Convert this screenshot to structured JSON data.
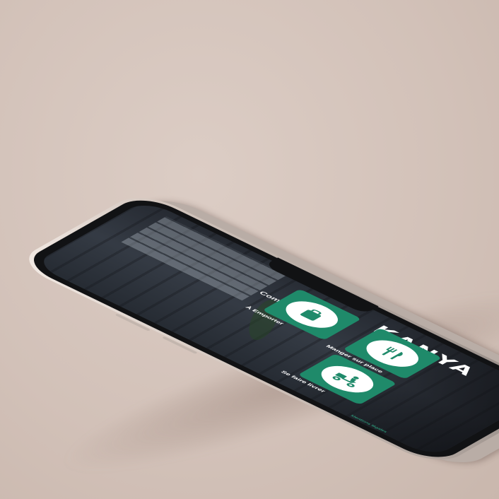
{
  "app": {
    "brand_name": "KANYA"
  },
  "main": {
    "title": "Commandez",
    "options": [
      {
        "label": "Manger sur place",
        "icon": "fork-knife-icon"
      },
      {
        "label": "À Emporter",
        "icon": "takeaway-bag-icon"
      },
      {
        "label": "Se faire livrer",
        "icon": "delivery-scooter-icon"
      }
    ],
    "legal_link": "Mentions légales"
  },
  "colors": {
    "accent": "#1f8a6a",
    "link": "#2fb08a",
    "background": "#d4c4bc"
  }
}
